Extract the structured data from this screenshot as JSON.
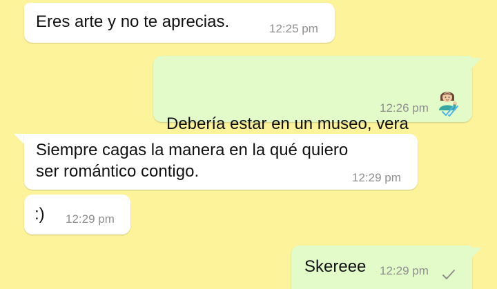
{
  "colors": {
    "chat_background": "#fdf39b",
    "incoming_bubble": "#ffffff",
    "outgoing_bubble": "#e2fbc8",
    "timestamp": "#8f8f8f",
    "read_ticks": "#4fb6ec",
    "sent_tick": "#8f8f8f"
  },
  "messages": [
    {
      "direction": "incoming",
      "text": "Eres arte y no te aprecias.",
      "time": "12:25 pm"
    },
    {
      "direction": "outgoing",
      "text": "Debería estar en un museo, vera",
      "emoji": "woman-tipping-hand-icon",
      "time": "12:26 pm",
      "status": "read"
    },
    {
      "direction": "incoming",
      "text_line1": "Siempre cagas la manera en la qué quiero",
      "text_line2": "ser romántico contigo.",
      "time": "12:29 pm"
    },
    {
      "direction": "incoming",
      "text": ":)",
      "time": "12:29 pm"
    },
    {
      "direction": "outgoing",
      "text": "Skereee",
      "time": "12:29 pm",
      "status": "sent"
    }
  ]
}
